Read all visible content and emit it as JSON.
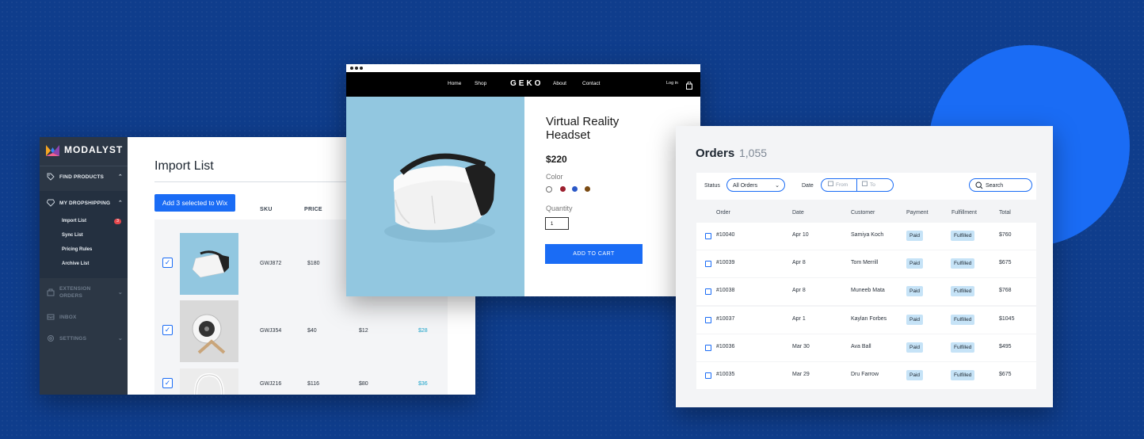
{
  "colors": {
    "background": "#0f3d8c",
    "accent": "#1a6cf5",
    "sidebar": "#2c3745",
    "paid_pill": "#c6e3f7"
  },
  "modalyst": {
    "brand": "MODALYST",
    "sidebar": {
      "find_products": "FIND PRODUCTS",
      "my_dropshipping": "MY DROPSHIPPING",
      "import_list": "Import List",
      "import_badge": "3",
      "sync_list": "Sync List",
      "pricing_rules": "Pricing Rules",
      "archive_list": "Archive List",
      "extension_orders_1": "EXTENSION",
      "extension_orders_2": "ORDERS",
      "inbox": "INBOX",
      "settings": "SETTINGS"
    },
    "title": "Import List",
    "add_button": "Add 3 selected to Wix",
    "columns": {
      "sku": "SKU",
      "price": "PRICE"
    },
    "rows": [
      {
        "sku": "GWJ872",
        "price": "$180",
        "cost": "",
        "profit": "",
        "thumb": "vr-headset"
      },
      {
        "sku": "GWJ354",
        "price": "$40",
        "cost": "$12",
        "profit": "$28",
        "thumb": "desk-fan"
      },
      {
        "sku": "GWJ216",
        "price": "$116",
        "cost": "$80",
        "profit": "$36",
        "thumb": "headphones"
      }
    ]
  },
  "geko": {
    "nav": {
      "home": "Home",
      "shop": "Shop",
      "logo": "GEKO",
      "about": "About",
      "contact": "Contact",
      "login": "Log in"
    },
    "product_name": "Virtual Reality Headset",
    "price": "$220",
    "color_label": "Color",
    "colors": [
      "#6e6e6e",
      "#9c1f2e",
      "#2b58c7",
      "#7a4a12"
    ],
    "quantity_label": "Quantity",
    "quantity_value": "1",
    "cart_button": "ADD TO CART"
  },
  "orders": {
    "title": "Orders",
    "count": "1,055",
    "filters": {
      "status_label": "Status",
      "status_value": "All Orders",
      "date_label": "Date",
      "from_placeholder": "From",
      "to_placeholder": "To",
      "search_placeholder": "Search"
    },
    "columns": {
      "order": "Order",
      "date": "Date",
      "customer": "Customer",
      "payment": "Payment",
      "fulfillment": "Fulfillment",
      "total": "Total"
    },
    "rows": [
      {
        "order": "#10040",
        "date": "Apr 10",
        "customer": "Samiya Koch",
        "payment": "Paid",
        "fulfillment": "Fulfilled",
        "total": "$760"
      },
      {
        "order": "#10039",
        "date": "Apr 8",
        "customer": "Tom Merrill",
        "payment": "Paid",
        "fulfillment": "Fulfilled",
        "total": "$675"
      },
      {
        "order": "#10038",
        "date": "Apr 8",
        "customer": "Muneeb Mata",
        "payment": "Paid",
        "fulfillment": "Fulfilled",
        "total": "$768"
      },
      {
        "order": "#10037",
        "date": "Apr 1",
        "customer": "Kaylan Forbes",
        "payment": "Paid",
        "fulfillment": "Fulfilled",
        "total": "$1045"
      },
      {
        "order": "#10036",
        "date": "Mar 30",
        "customer": "Ava Ball",
        "payment": "Paid",
        "fulfillment": "Fulfilled",
        "total": "$495"
      },
      {
        "order": "#10035",
        "date": "Mar 29",
        "customer": "Dru Farrow",
        "payment": "Paid",
        "fulfillment": "Fulfilled",
        "total": "$675"
      }
    ]
  }
}
